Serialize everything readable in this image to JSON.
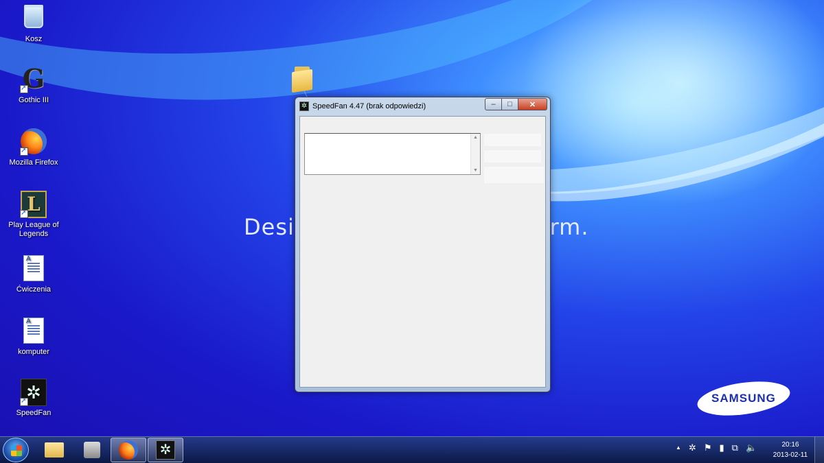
{
  "desktop": {
    "icons": [
      {
        "label": "Kosz"
      },
      {
        "label": "Gothic III"
      },
      {
        "label": "Mozilla Firefox"
      },
      {
        "label": "Play League of Legends"
      },
      {
        "label": "Ćwiczenia"
      },
      {
        "label": "komputer"
      },
      {
        "label": "SpeedFan"
      }
    ],
    "wallpaper": {
      "slogan_left": "Desig",
      "slogan_right": "orm.",
      "brand": "SAMSUNG",
      "colors": {
        "deep_blue": "#1a19c9",
        "light_blue": "#9fe0ff"
      }
    }
  },
  "window": {
    "title": "SpeedFan 4.47 (brak odpowiedzi)",
    "controls": {
      "minimize": "–",
      "maximize": "□",
      "close": "✕"
    }
  },
  "taskbar": {
    "items": [
      {
        "icon": "windows-explorer-icon"
      },
      {
        "icon": "media-icon"
      },
      {
        "icon": "firefox-icon"
      },
      {
        "icon": "speedfan-icon"
      }
    ],
    "tray": {
      "show_hidden": "▲",
      "icons": [
        "speedfan-tray-icon",
        "action-center-flag-icon",
        "power-icon",
        "network-icon",
        "volume-icon"
      ]
    },
    "clock": {
      "time": "20:16",
      "date": "2013-02-11"
    }
  }
}
